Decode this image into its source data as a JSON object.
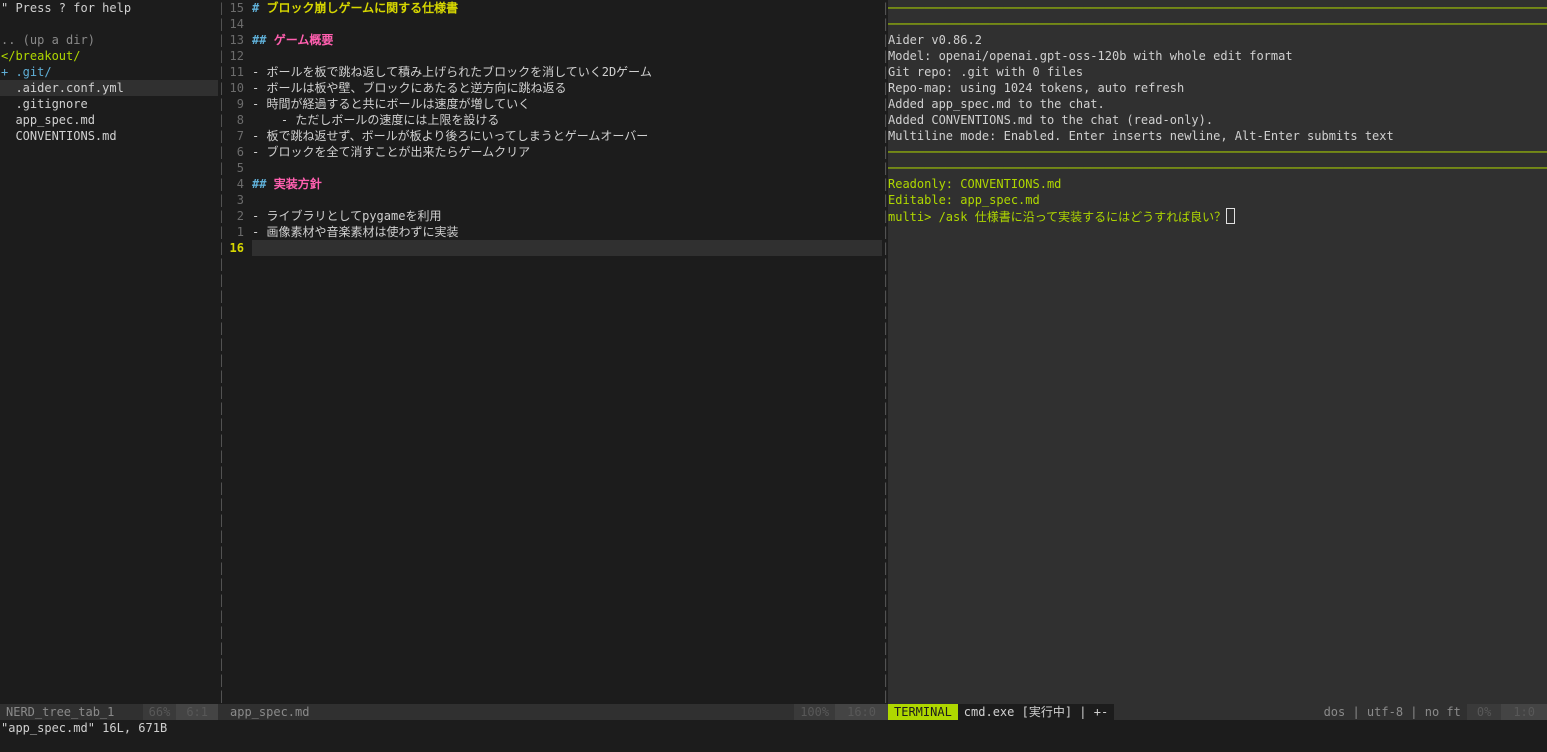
{
  "nerdtree": {
    "help": "\" Press ? for help",
    "updir": ".. (up a dir)",
    "root": "</breakout/",
    "items": [
      {
        "label": "+ .git/",
        "type": "dir"
      },
      {
        "label": "  .aider.conf.yml",
        "type": "file"
      },
      {
        "label": "  .gitignore",
        "type": "file"
      },
      {
        "label": "  app_spec.md",
        "type": "file"
      },
      {
        "label": "  CONVENTIONS.md",
        "type": "file"
      }
    ]
  },
  "editor": {
    "lines": [
      {
        "num": "15",
        "kind": "h1",
        "mark": "# ",
        "text": "ブロック崩しゲームに関する仕様書"
      },
      {
        "num": "14",
        "kind": "blank",
        "text": ""
      },
      {
        "num": "13",
        "kind": "h2",
        "mark": "## ",
        "text": "ゲーム概要"
      },
      {
        "num": "12",
        "kind": "blank",
        "text": ""
      },
      {
        "num": "11",
        "kind": "text",
        "text": "- ボールを板で跳ね返して積み上げられたブロックを消していく2Dゲーム"
      },
      {
        "num": "10",
        "kind": "text",
        "text": "- ボールは板や壁、ブロックにあたると逆方向に跳ね返る"
      },
      {
        "num": "9",
        "kind": "text",
        "text": "- 時間が経過すると共にボールは速度が増していく"
      },
      {
        "num": "8",
        "kind": "text",
        "text": "    - ただしボールの速度には上限を設ける"
      },
      {
        "num": "7",
        "kind": "text",
        "text": "- 板で跳ね返せず、ボールが板より後ろにいってしまうとゲームオーバー"
      },
      {
        "num": "6",
        "kind": "text",
        "text": "- ブロックを全て消すことが出来たらゲームクリア"
      },
      {
        "num": "5",
        "kind": "blank",
        "text": ""
      },
      {
        "num": "4",
        "kind": "h2",
        "mark": "## ",
        "text": "実装方針"
      },
      {
        "num": "3",
        "kind": "blank",
        "text": ""
      },
      {
        "num": "2",
        "kind": "text",
        "text": "- ライブラリとしてpygameを利用"
      },
      {
        "num": "1",
        "kind": "text",
        "text": "- 画像素材や音楽素材は使わずに実装"
      },
      {
        "num": "16",
        "kind": "current",
        "text": ""
      }
    ]
  },
  "terminal": {
    "lines": [
      {
        "kind": "rule",
        "text": "────────────────────────────────────────────────────────────────────────────────────────────────"
      },
      {
        "kind": "rule",
        "text": "────────────────────────────────────────────────────────────────────────────────────────────────"
      },
      {
        "kind": "plain",
        "text": "Aider v0.86.2"
      },
      {
        "kind": "plain",
        "text": "Model: openai/openai.gpt-oss-120b with whole edit format"
      },
      {
        "kind": "plain",
        "text": "Git repo: .git with 0 files"
      },
      {
        "kind": "plain",
        "text": "Repo-map: using 1024 tokens, auto refresh"
      },
      {
        "kind": "plain",
        "text": "Added app_spec.md to the chat."
      },
      {
        "kind": "plain",
        "text": "Added CONVENTIONS.md to the chat (read-only)."
      },
      {
        "kind": "plain",
        "text": "Multiline mode: Enabled. Enter inserts newline, Alt-Enter submits text"
      },
      {
        "kind": "rule",
        "text": "────────────────────────────────────────────────────────────────────────────────────────────────"
      },
      {
        "kind": "rule",
        "text": "────────────────────────────────────────────────────────────────────────────────────────────────"
      },
      {
        "kind": "green",
        "text": "Readonly: CONVENTIONS.md"
      },
      {
        "kind": "green",
        "text": "Editable: app_spec.md"
      }
    ],
    "prompt": "multi> /ask 仕様書に沿って実装するにはどうすれば良い？"
  },
  "status": {
    "nerd_name": "NERD_tree_tab_1",
    "nerd_pct": "66%",
    "nerd_pos": "6:1",
    "edit_name": "app_spec.md",
    "edit_pct": "100%",
    "edit_pos": "16:0",
    "term_mode": "TERMINAL",
    "term_name": "cmd.exe [実行中] | +-",
    "term_info": "dos | utf-8 | no ft",
    "term_pct": "0%",
    "term_pos": "1:0"
  },
  "cmdline": "\"app_spec.md\" 16L, 671B",
  "colors": {
    "accent": "#afd700",
    "heading": "#ff5faf",
    "title": "#d7d700",
    "directory": "#5fafd7"
  }
}
